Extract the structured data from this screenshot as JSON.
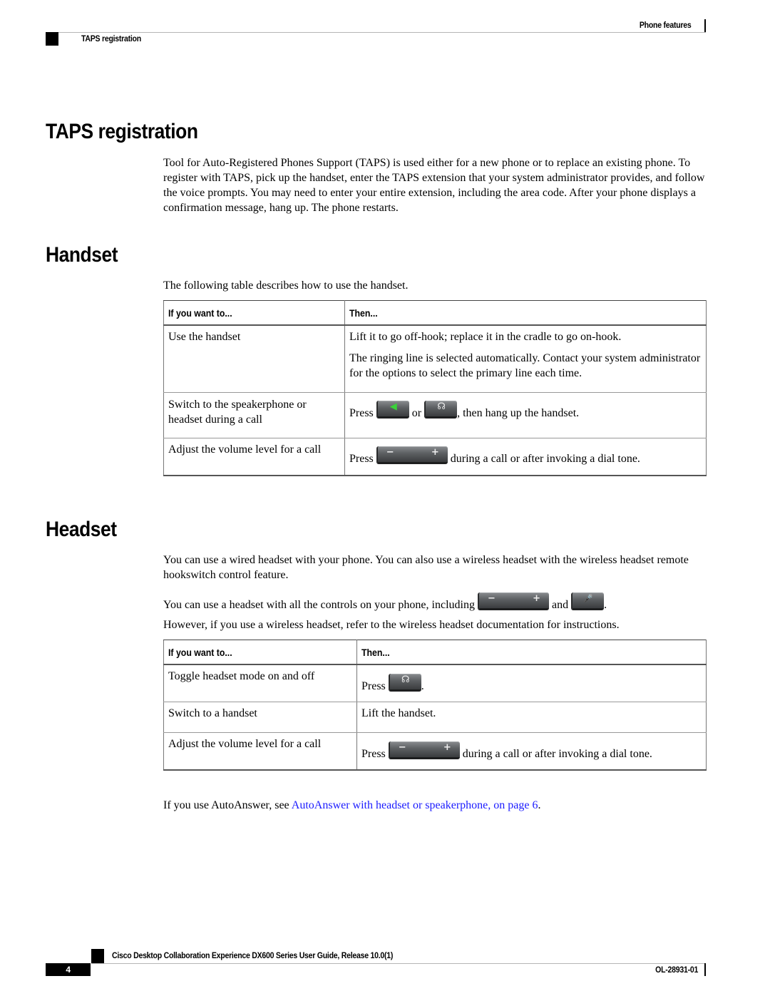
{
  "header": {
    "chapter": "Phone features",
    "section": "TAPS registration"
  },
  "taps": {
    "title": "TAPS registration",
    "body": "Tool for Auto-Registered Phones Support (TAPS) is used either for a new phone or to replace an existing phone. To register with TAPS, pick up the handset, enter the TAPS extension that your system administrator provides, and follow the voice prompts. You may need to enter your entire extension, including the area code. After your phone displays a confirmation message, hang up. The phone restarts."
  },
  "handset": {
    "title": "Handset",
    "intro": "The following table describes how to use the handset.",
    "table": {
      "headers": [
        "If you want to...",
        "Then..."
      ],
      "rows": [
        {
          "action": "Use the handset",
          "then_lines": [
            "Lift it to go off-hook; replace it in the cradle to go on-hook.",
            "The ringing line is selected automatically. Contact your system administrator for the options to select the primary line each time."
          ]
        },
        {
          "action": "Switch to the speakerphone or headset during a call",
          "then_prefix": "Press",
          "then_mid": "or",
          "then_suffix": ", then hang up the handset.",
          "icons": [
            "speakerphone-key",
            "headset-key"
          ]
        },
        {
          "action": "Adjust the volume level for a call",
          "then_prefix": "Press",
          "then_suffix": "during a call or after invoking a dial tone.",
          "icons": [
            "volume-key"
          ]
        }
      ]
    }
  },
  "headset": {
    "title": "Headset",
    "para1": "You can use a wired headset with your phone. You can also use a wireless headset with the wireless headset remote hookswitch control feature.",
    "para2_prefix": "You can use a headset with all the controls on your phone, including",
    "para2_mid": "and",
    "para2_suffix": ".",
    "para2_icons": [
      "volume-key",
      "mute-key"
    ],
    "para3": "However, if you use a wireless headset, refer to the wireless headset documentation for instructions.",
    "table": {
      "headers": [
        "If you want to...",
        "Then..."
      ],
      "rows": [
        {
          "action": "Toggle headset mode on and off",
          "then_prefix": "Press",
          "then_suffix": ".",
          "icons": [
            "headset-key"
          ]
        },
        {
          "action": "Switch to a handset",
          "then_text": "Lift the handset."
        },
        {
          "action": "Adjust the volume level for a call",
          "then_prefix": "Press",
          "then_suffix": "during a call or after invoking a dial tone.",
          "icons": [
            "volume-key"
          ]
        }
      ]
    },
    "autoanswer_prefix": "If you use AutoAnswer, see",
    "autoanswer_link": "AutoAnswer with headset or speakerphone,  on page 6",
    "autoanswer_suffix": "."
  },
  "footer": {
    "title": "Cisco Desktop Collaboration Experience DX600 Series User Guide, Release 10.0(1)",
    "page_number": "4",
    "doc_number": "OL-28931-01"
  },
  "icons": {
    "volume_minus": "−",
    "volume_plus": "+",
    "speaker_glyph": "◀",
    "headset_glyph": "☊",
    "mute_glyph": "🎤"
  },
  "colors": {
    "link": "#1a1aff",
    "speaker_green": "#3ad23a"
  }
}
